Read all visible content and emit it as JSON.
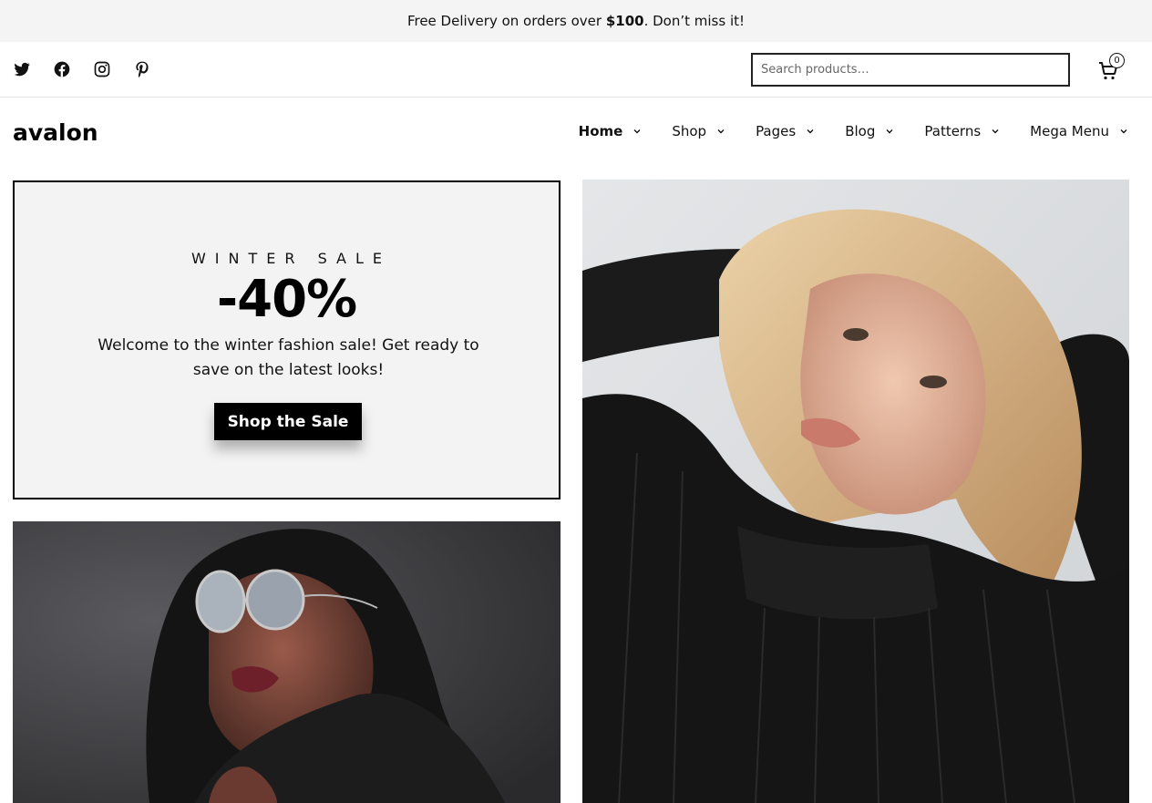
{
  "announcement": {
    "prefix": "Free Delivery on orders over ",
    "amount": "$100",
    "suffix": ". Don’t miss it!"
  },
  "social": [
    "twitter-icon",
    "facebook-icon",
    "instagram-icon",
    "pinterest-icon"
  ],
  "search": {
    "placeholder": "Search products…"
  },
  "cart": {
    "count": "0"
  },
  "logo": "avalon",
  "nav": [
    {
      "label": "Home",
      "active": true
    },
    {
      "label": "Shop"
    },
    {
      "label": "Pages"
    },
    {
      "label": "Blog"
    },
    {
      "label": "Patterns"
    },
    {
      "label": "Mega Menu"
    }
  ],
  "promo": {
    "eyebrow": "WINTER SALE",
    "headline": "-40%",
    "description": "Welcome to the winter fashion sale! Get ready to save on the latest looks!",
    "cta": "Shop the Sale",
    "background": "#f3f3f3"
  },
  "colors": {
    "accent": "#000000",
    "topbar": "#f4f4f4"
  }
}
